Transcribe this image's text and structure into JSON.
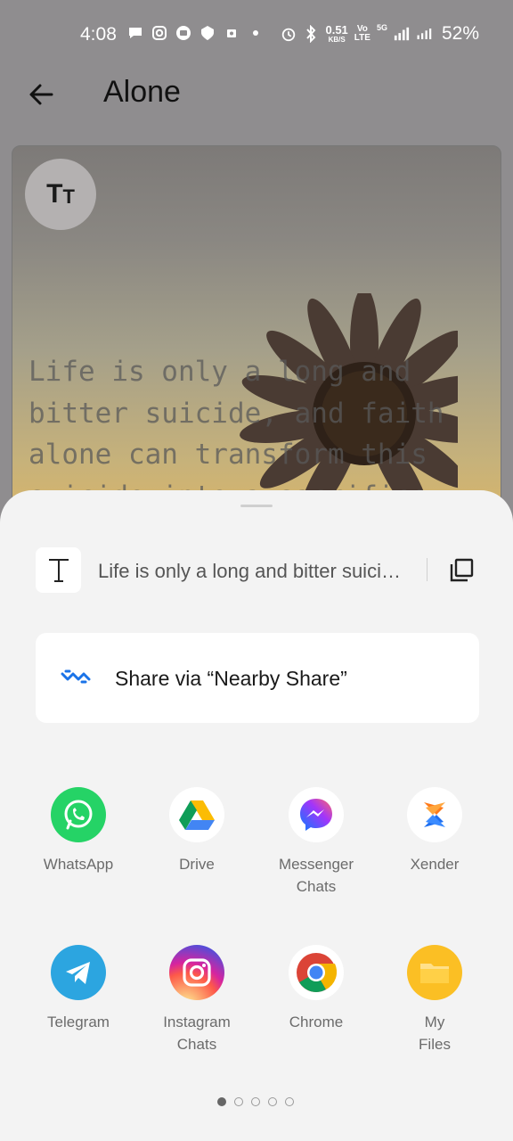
{
  "status_bar": {
    "time": "4:08",
    "net_speed_value": "0.51",
    "net_speed_unit": "KB/S",
    "volte_top": "Vo",
    "volte_bottom": "LTE",
    "network": "5G",
    "battery": "52%"
  },
  "app_bar": {
    "title": "Alone"
  },
  "card": {
    "format_button": {
      "big": "T",
      "small": "T"
    },
    "quote": "Life is only a long and\nbitter suicide, and faith\nalone can transform this\nsuicide into a sacrifice."
  },
  "share_sheet": {
    "preview_text": "Life is only a long and bitter suicide, and faith alone can transform this suicide into a sacrifice.",
    "nearby_share_label": "Share via “Nearby Share”",
    "apps": [
      {
        "label": "WhatsApp",
        "icon": "whatsapp-icon",
        "color": "#25d366"
      },
      {
        "label": "Drive",
        "icon": "google-drive-icon",
        "color": "#ffffff"
      },
      {
        "label": "Messenger Chats",
        "icon": "messenger-icon",
        "color": "#ffffff"
      },
      {
        "label": "Xender",
        "icon": "xender-icon",
        "color": "#ffffff"
      },
      {
        "label": "Telegram",
        "icon": "telegram-icon",
        "color": "#2ca5e0"
      },
      {
        "label": "Instagram Chats",
        "icon": "instagram-icon",
        "color": "#e1306c"
      },
      {
        "label": "Chrome",
        "icon": "chrome-icon",
        "color": "#ffffff"
      },
      {
        "label": "My Files",
        "icon": "folder-icon",
        "color": "#fbbf24"
      }
    ],
    "page_indicator": {
      "pages": 5,
      "current": 1
    }
  }
}
